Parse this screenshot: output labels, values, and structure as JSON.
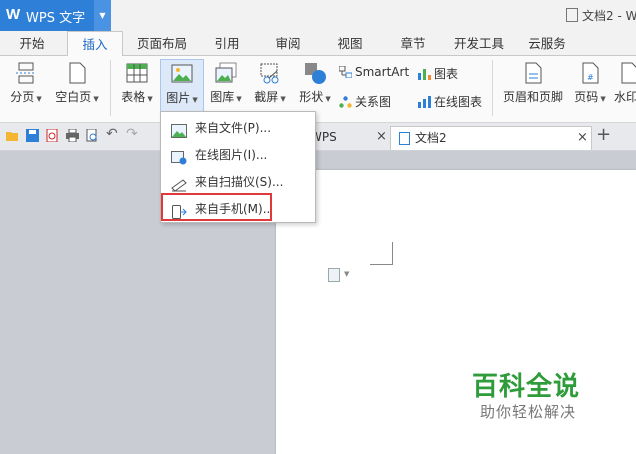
{
  "app": {
    "logo_letter": "W",
    "title": "WPS 文字",
    "doc_title": "文档2 - W"
  },
  "menu_tabs": [
    "开始",
    "插入",
    "页面布局",
    "引用",
    "审阅",
    "视图",
    "章节",
    "开发工具",
    "云服务"
  ],
  "ribbon": {
    "page_break": "分页",
    "blank_page": "空白页",
    "table": "表格",
    "picture": "图片",
    "gallery": "图库",
    "screenshot": "截屏",
    "shapes": "形状",
    "smartart": "SmartArt",
    "chart": "图表",
    "relation": "关系图",
    "online_chart": "在线图表",
    "header_footer": "页眉和页脚",
    "page_number": "页码",
    "watermark": "水印"
  },
  "doc_tabs": {
    "my_wps": "我的WPS",
    "doc2": "文档2"
  },
  "dropdown": {
    "from_file": "来自文件(P)...",
    "online_pic": "在线图片(I)...",
    "from_scanner": "来自扫描仪(S)...",
    "from_phone": "来自手机(M).."
  },
  "watermark": {
    "line1": "百科全说",
    "line2": "助你轻松解决"
  },
  "colors": {
    "accent": "#2e7fd8",
    "highlight": "#e0393c",
    "brand_green": "#2e9c3a"
  }
}
